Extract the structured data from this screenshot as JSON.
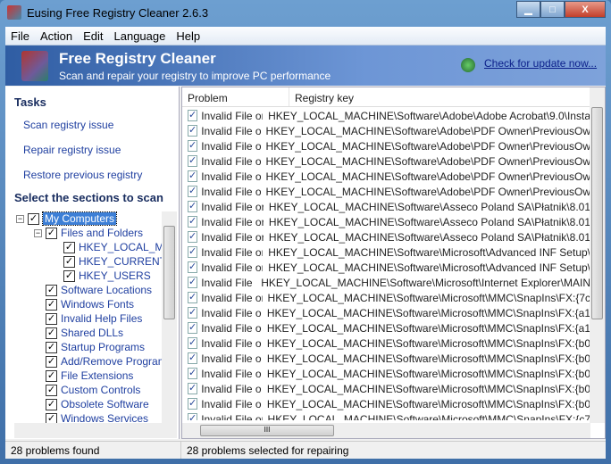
{
  "window": {
    "title": "Eusing Free Registry Cleaner 2.6.3",
    "minimize": "▁",
    "maximize": "□",
    "close": "X"
  },
  "menu": [
    "File",
    "Action",
    "Edit",
    "Language",
    "Help"
  ],
  "banner": {
    "title": "Free Registry Cleaner",
    "subtitle": "Scan and repair your registry to improve PC performance",
    "update_link": "Check for update now..."
  },
  "tasks": {
    "heading": "Tasks",
    "items": [
      "Scan registry issue",
      "Repair registry issue",
      "Restore previous registry"
    ]
  },
  "sections": {
    "heading": "Select the sections to scan",
    "tree": [
      {
        "label": "My Computers",
        "level": 0,
        "expander": "−",
        "selected": true
      },
      {
        "label": "Files and Folders",
        "level": 1,
        "expander": "−"
      },
      {
        "label": "HKEY_LOCAL_MACHINE",
        "level": 2
      },
      {
        "label": "HKEY_CURRENT_USER",
        "level": 2
      },
      {
        "label": "HKEY_USERS",
        "level": 2
      },
      {
        "label": "Software Locations",
        "level": 1
      },
      {
        "label": "Windows Fonts",
        "level": 1
      },
      {
        "label": "Invalid Help Files",
        "level": 1
      },
      {
        "label": "Shared DLLs",
        "level": 1
      },
      {
        "label": "Startup Programs",
        "level": 1
      },
      {
        "label": "Add/Remove Programs",
        "level": 1
      },
      {
        "label": "File Extensions",
        "level": 1
      },
      {
        "label": "Custom Controls",
        "level": 1
      },
      {
        "label": "Obsolete Software",
        "level": 1
      },
      {
        "label": "Windows Services",
        "level": 1
      }
    ]
  },
  "table": {
    "columns": [
      "Problem",
      "Registry key"
    ],
    "rows": [
      {
        "problem": "Invalid File or Folder",
        "key": "HKEY_LOCAL_MACHINE\\Software\\Adobe\\Adobe Acrobat\\9.0\\Insta"
      },
      {
        "problem": "Invalid File or Folder",
        "key": "HKEY_LOCAL_MACHINE\\Software\\Adobe\\PDF Owner\\PreviousOw"
      },
      {
        "problem": "Invalid File or Folder",
        "key": "HKEY_LOCAL_MACHINE\\Software\\Adobe\\PDF Owner\\PreviousOw"
      },
      {
        "problem": "Invalid File or Folder",
        "key": "HKEY_LOCAL_MACHINE\\Software\\Adobe\\PDF Owner\\PreviousOw"
      },
      {
        "problem": "Invalid File or Folder",
        "key": "HKEY_LOCAL_MACHINE\\Software\\Adobe\\PDF Owner\\PreviousOw"
      },
      {
        "problem": "Invalid File or Folder",
        "key": "HKEY_LOCAL_MACHINE\\Software\\Adobe\\PDF Owner\\PreviousOw"
      },
      {
        "problem": "Invalid File or Folder",
        "key": "HKEY_LOCAL_MACHINE\\Software\\Asseco Poland SA\\Płatnik\\8.01"
      },
      {
        "problem": "Invalid File or Folder",
        "key": "HKEY_LOCAL_MACHINE\\Software\\Asseco Poland SA\\Płatnik\\8.01"
      },
      {
        "problem": "Invalid File or Folder",
        "key": "HKEY_LOCAL_MACHINE\\Software\\Asseco Poland SA\\Płatnik\\8.01"
      },
      {
        "problem": "Invalid File or Folder",
        "key": "HKEY_LOCAL_MACHINE\\Software\\Microsoft\\Advanced INF Setup\\"
      },
      {
        "problem": "Invalid File or Folder",
        "key": "HKEY_LOCAL_MACHINE\\Software\\Microsoft\\Advanced INF Setup\\"
      },
      {
        "problem": "Invalid File or Folder",
        "key": "HKEY_LOCAL_MACHINE\\Software\\Microsoft\\Internet Explorer\\MAIN"
      },
      {
        "problem": "Invalid File or Folder",
        "key": "HKEY_LOCAL_MACHINE\\Software\\Microsoft\\MMC\\SnapIns\\FX:{7c"
      },
      {
        "problem": "Invalid File or Folder",
        "key": "HKEY_LOCAL_MACHINE\\Software\\Microsoft\\MMC\\SnapIns\\FX:{a1"
      },
      {
        "problem": "Invalid File or Folder",
        "key": "HKEY_LOCAL_MACHINE\\Software\\Microsoft\\MMC\\SnapIns\\FX:{a1"
      },
      {
        "problem": "Invalid File or Folder",
        "key": "HKEY_LOCAL_MACHINE\\Software\\Microsoft\\MMC\\SnapIns\\FX:{b0"
      },
      {
        "problem": "Invalid File or Folder",
        "key": "HKEY_LOCAL_MACHINE\\Software\\Microsoft\\MMC\\SnapIns\\FX:{b0"
      },
      {
        "problem": "Invalid File or Folder",
        "key": "HKEY_LOCAL_MACHINE\\Software\\Microsoft\\MMC\\SnapIns\\FX:{b0"
      },
      {
        "problem": "Invalid File or Folder",
        "key": "HKEY_LOCAL_MACHINE\\Software\\Microsoft\\MMC\\SnapIns\\FX:{b0"
      },
      {
        "problem": "Invalid File or Folder",
        "key": "HKEY_LOCAL_MACHINE\\Software\\Microsoft\\MMC\\SnapIns\\FX:{b0"
      },
      {
        "problem": "Invalid File or Folder",
        "key": "HKEY_LOCAL_MACHINE\\Software\\Microsoft\\MMC\\SnapIns\\FX:{c7"
      }
    ]
  },
  "status": {
    "found": "28 problems found",
    "selected": "28 problems selected for repairing"
  },
  "glyphs": {
    "check": "✓",
    "scroll_grip": "≡",
    "hscroll_grip": "III"
  }
}
